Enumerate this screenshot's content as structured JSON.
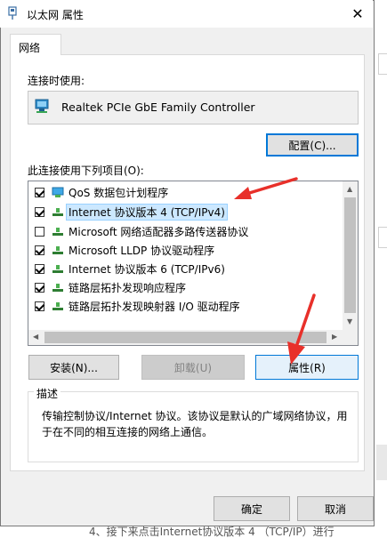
{
  "window": {
    "title": "以太网 属性",
    "close_glyph": "✕"
  },
  "tabs": [
    {
      "label": "网络",
      "active": true
    }
  ],
  "connect_using": {
    "label": "连接时使用:",
    "adapter": "Realtek PCIe GbE Family Controller",
    "configure_button": "配置(C)..."
  },
  "items": {
    "label": "此连接使用下列项目(O):",
    "list": [
      {
        "label": "QoS 数据包计划程序",
        "checked": true,
        "icon": "qos-scheduler-icon"
      },
      {
        "label": "Internet 协议版本 4 (TCP/IPv4)",
        "checked": true,
        "icon": "network-protocol-icon",
        "selected": true
      },
      {
        "label": "Microsoft 网络适配器多路传送器协议",
        "checked": false,
        "icon": "network-protocol-icon"
      },
      {
        "label": "Microsoft LLDP 协议驱动程序",
        "checked": true,
        "icon": "network-protocol-icon"
      },
      {
        "label": "Internet 协议版本 6 (TCP/IPv6)",
        "checked": true,
        "icon": "network-protocol-icon"
      },
      {
        "label": "链路层拓扑发现响应程序",
        "checked": true,
        "icon": "network-protocol-icon"
      },
      {
        "label": "链路层拓扑发现映射器 I/O 驱动程序",
        "checked": true,
        "icon": "network-protocol-icon"
      }
    ]
  },
  "buttons": {
    "install": "安装(N)...",
    "uninstall": "卸载(U)",
    "properties": "属性(R)",
    "ok": "确定",
    "cancel": "取消"
  },
  "description": {
    "title": "描述",
    "text": "传输控制协议/Internet 协议。该协议是默认的广域网络协议，用于在不同的相互连接的网络上通信。"
  },
  "background_snippet": "4、接下来点击Internet协议版本 4 （TCP/IP）进行",
  "colors": {
    "accent": "#0078d7",
    "annotation_arrow": "#e8302a",
    "selection": "#cce8ff"
  }
}
